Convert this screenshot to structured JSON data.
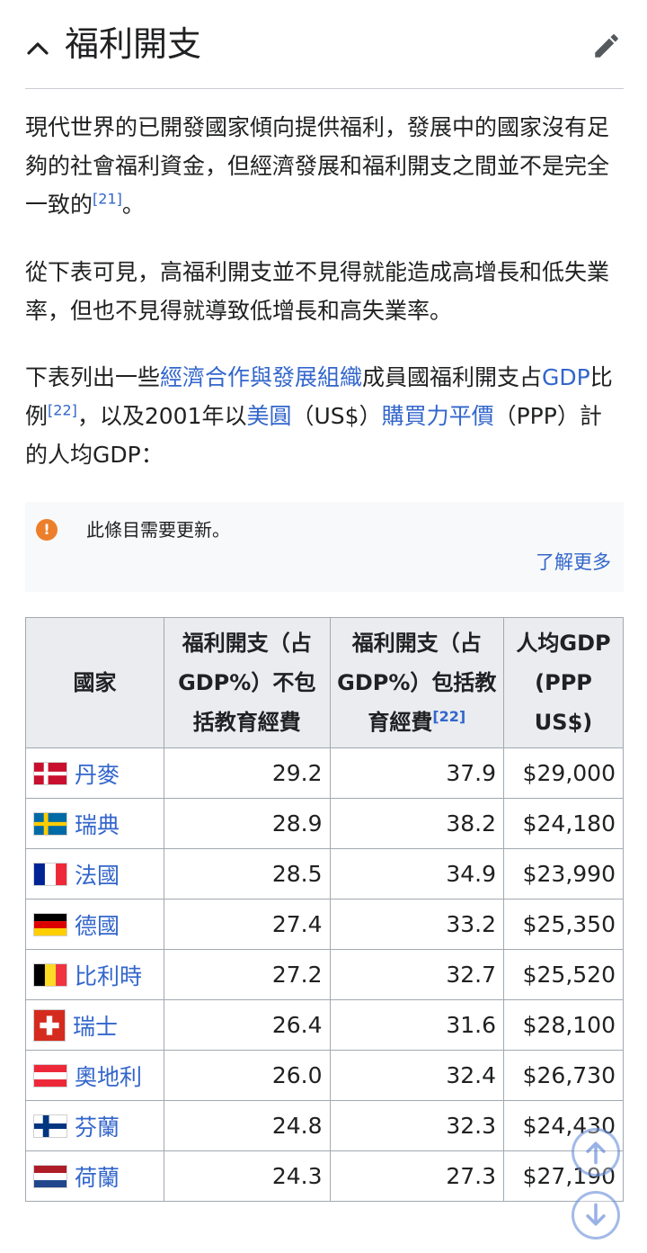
{
  "section": {
    "title": "福利開支",
    "collapse_icon": "chevron-up-icon",
    "edit_icon": "pencil-icon"
  },
  "paragraphs": {
    "p1": {
      "text": "現代世界的已開發國家傾向提供福利，發展中的國家沒有足夠的社會福利資金，但經濟發展和福利開支之間並不是完全一致的",
      "ref": "[21]",
      "end": "。"
    },
    "p2": {
      "text": "從下表可見，高福利開支並不見得就能造成高增長和低失業率，但也不見得就導致低增長和高失業率。"
    },
    "p3": {
      "t1": "下表列出一些",
      "link1": "經濟合作與發展組織",
      "t2": "成員國福利開支占",
      "link2": "GDP",
      "t3": "比例",
      "ref": "[22]",
      "t4": "，以及2001年以",
      "link3": "美圓",
      "t5": "（US$）",
      "link4": "購買力平價",
      "t6": "（PPP）計的人均GDP："
    }
  },
  "notice": {
    "icon": "exclamation-icon",
    "text": "此條目需要更新。",
    "link": "了解更多"
  },
  "table": {
    "headers": {
      "country": "國家",
      "welfare_excl": "福利開支（占GDP%）不包括教育經費",
      "welfare_incl": "福利開支（占GDP%）包括教育經費",
      "welfare_incl_ref": "[22]",
      "gdp": "人均GDP (PPP US$)"
    },
    "rows": [
      {
        "country": "丹麥",
        "flag": "denmark-flag-icon",
        "excl": "29.2",
        "incl": "37.9",
        "gdp": "$29,000"
      },
      {
        "country": "瑞典",
        "flag": "sweden-flag-icon",
        "excl": "28.9",
        "incl": "38.2",
        "gdp": "$24,180"
      },
      {
        "country": "法國",
        "flag": "france-flag-icon",
        "excl": "28.5",
        "incl": "34.9",
        "gdp": "$23,990"
      },
      {
        "country": "德國",
        "flag": "germany-flag-icon",
        "excl": "27.4",
        "incl": "33.2",
        "gdp": "$25,350"
      },
      {
        "country": "比利時",
        "flag": "belgium-flag-icon",
        "excl": "27.2",
        "incl": "32.7",
        "gdp": "$25,520"
      },
      {
        "country": "瑞士",
        "flag": "switzerland-flag-icon",
        "excl": "26.4",
        "incl": "31.6",
        "gdp": "$28,100"
      },
      {
        "country": "奧地利",
        "flag": "austria-flag-icon",
        "excl": "26.0",
        "incl": "32.4",
        "gdp": "$26,730"
      },
      {
        "country": "芬蘭",
        "flag": "finland-flag-icon",
        "excl": "24.8",
        "incl": "32.3",
        "gdp": "$24,430"
      },
      {
        "country": "荷蘭",
        "flag": "netherlands-flag-icon",
        "excl": "24.3",
        "incl": "27.3",
        "gdp": "$27,190"
      }
    ]
  },
  "floating": {
    "scroll_up_icon": "arrow-up-circle-icon",
    "scroll_down_icon": "arrow-down-circle-icon"
  },
  "colors": {
    "link": "#3366cc",
    "notice_icon": "#ec7f2c",
    "header_bg": "#eaecf0",
    "border": "#a2a9b1"
  }
}
